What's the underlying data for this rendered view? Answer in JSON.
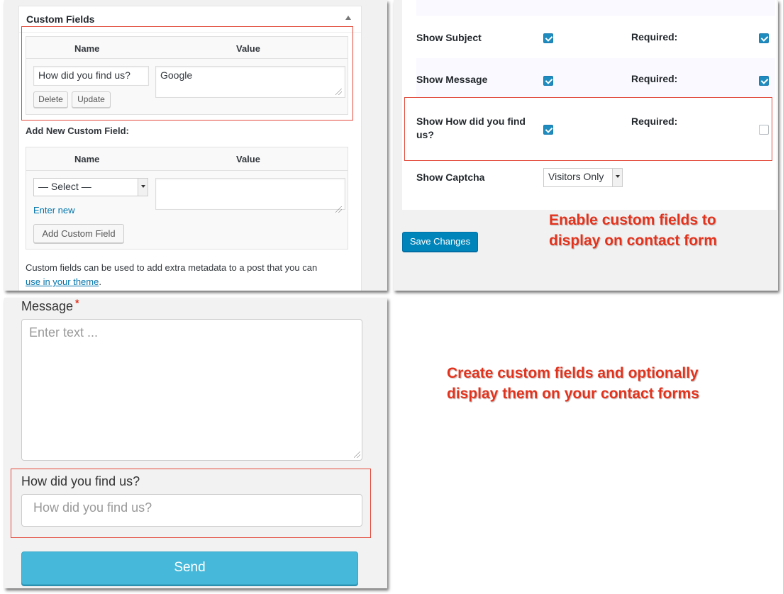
{
  "custom_fields_box": {
    "title": "Custom Fields",
    "existing_table": {
      "col_name": "Name",
      "col_value": "Value",
      "field_name": "How did you find us?",
      "field_value": "Google",
      "delete_label": "Delete",
      "update_label": "Update"
    },
    "add_new": {
      "heading": "Add New Custom Field:",
      "col_name": "Name",
      "col_value": "Value",
      "select_value": "— Select —",
      "enter_new_label": "Enter new",
      "add_button_label": "Add Custom Field"
    },
    "help_text": "Custom fields can be used to add extra metadata to a post that you can",
    "help_link": "use in your theme",
    "help_suffix": "."
  },
  "settings": {
    "rows": [
      {
        "label": "Show Subject",
        "checked": true,
        "required_label": "Required:",
        "required": true
      },
      {
        "label": "Show Message",
        "checked": true,
        "required_label": "Required:",
        "required": true
      },
      {
        "label": "Show How did you find us?",
        "checked": true,
        "required_label": "Required:",
        "required": false
      }
    ],
    "captcha_label": "Show Captcha",
    "captcha_value": "Visitors Only",
    "save_label": "Save Changes",
    "callout_line1": "Enable custom fields to",
    "callout_line2": "display on contact form"
  },
  "contact_form": {
    "message_label": "Message",
    "message_required_mark": "*",
    "message_placeholder": "Enter text ...",
    "custom_label": "How did you find us?",
    "custom_placeholder": "How did you find us?",
    "send_label": "Send"
  },
  "callout_bottom": {
    "line1": "Create custom fields and optionally",
    "line2": "display them on your contact forms"
  },
  "colors": {
    "annotation_red": "#e3321c",
    "checkbox_blue": "#1e8cbe",
    "primary_button": "#0085ba",
    "send_button": "#46b8da"
  }
}
